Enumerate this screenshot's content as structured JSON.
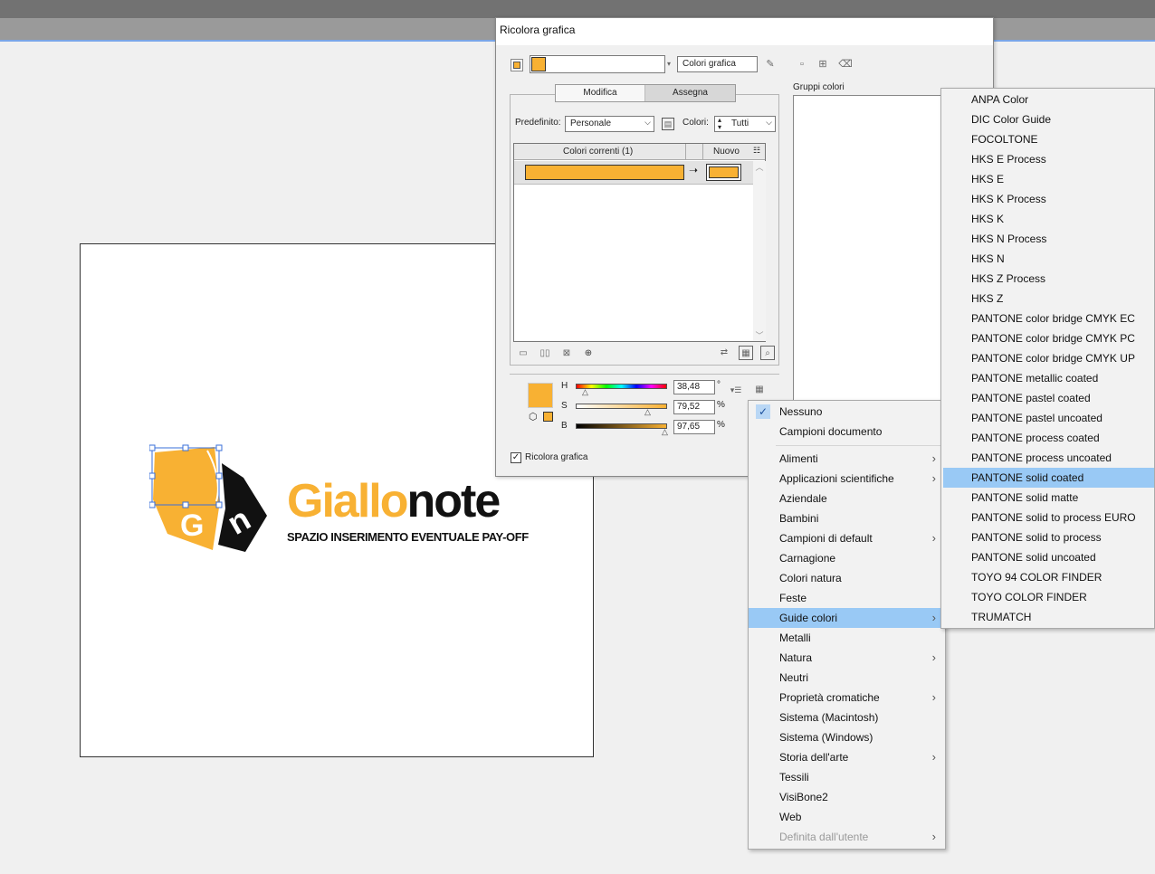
{
  "dialog": {
    "title": "Ricolora grafica",
    "art_colors_label": "Colori grafica",
    "tabs": [
      "Modifica",
      "Assegna"
    ],
    "preset_label": "Predefinito:",
    "preset_value": "Personale",
    "colors_label": "Colori:",
    "colors_value": "Tutti",
    "col_current": "Colori correnti (1)",
    "col_new": "Nuovo",
    "groups_label": "Gruppi colori",
    "h_label": "H",
    "s_label": "S",
    "b_label": "B",
    "h_value": "38,48",
    "s_value": "79,52",
    "b_value": "97,65",
    "h_unit": "°",
    "s_unit": "%",
    "b_unit": "%",
    "recolor_checkbox": "Ricolora grafica",
    "accent_color": "#f8b133"
  },
  "artboard": {
    "brand_part1": "Giallo",
    "brand_part2": "note",
    "payoff": "SPAZIO INSERIMENTO EVENTUALE PAY-OFF",
    "logo_letter_g": "G",
    "logo_letter_n": "n"
  },
  "menu1": {
    "items": [
      {
        "label": "Nessuno",
        "checked": true
      },
      {
        "label": "Campioni documento"
      },
      {
        "label": "Alimenti",
        "submenu": true
      },
      {
        "label": "Applicazioni scientifiche",
        "submenu": true
      },
      {
        "label": "Aziendale"
      },
      {
        "label": "Bambini"
      },
      {
        "label": "Campioni di default",
        "submenu": true
      },
      {
        "label": "Carnagione"
      },
      {
        "label": "Colori natura"
      },
      {
        "label": "Feste"
      },
      {
        "label": "Guide colori",
        "submenu": true,
        "highlighted": true
      },
      {
        "label": "Metalli"
      },
      {
        "label": "Natura",
        "submenu": true
      },
      {
        "label": "Neutri"
      },
      {
        "label": "Proprietà cromatiche",
        "submenu": true
      },
      {
        "label": "Sistema (Macintosh)"
      },
      {
        "label": "Sistema (Windows)"
      },
      {
        "label": "Storia dell'arte",
        "submenu": true
      },
      {
        "label": "Tessili"
      },
      {
        "label": "VisiBone2"
      },
      {
        "label": "Web"
      },
      {
        "label": "Definita dall'utente",
        "submenu": true,
        "disabled": true
      }
    ]
  },
  "menu2": {
    "items": [
      "ANPA Color",
      "DIC Color Guide",
      "FOCOLTONE",
      "HKS E Process",
      "HKS E",
      "HKS K Process",
      "HKS K",
      "HKS N Process",
      "HKS N",
      "HKS Z Process",
      "HKS Z",
      "PANTONE color bridge CMYK EC",
      "PANTONE color bridge CMYK PC",
      "PANTONE color bridge CMYK UP",
      "PANTONE metallic coated",
      "PANTONE pastel coated",
      "PANTONE pastel uncoated",
      "PANTONE process coated",
      "PANTONE process uncoated",
      "PANTONE solid coated",
      "PANTONE solid matte",
      "PANTONE solid to process EURO",
      "PANTONE solid to process",
      "PANTONE solid uncoated",
      "TOYO 94 COLOR FINDER",
      "TOYO COLOR FINDER",
      "TRUMATCH"
    ],
    "highlighted": "PANTONE solid coated"
  }
}
